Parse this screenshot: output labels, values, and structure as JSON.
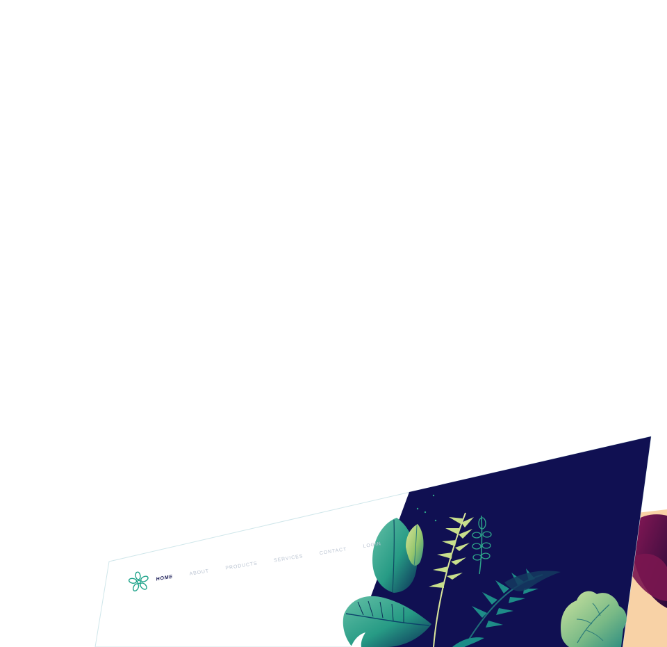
{
  "site": {
    "logo_icon": "leaf-flower-logo-icon",
    "nav": [
      {
        "label": "HOME",
        "active": true
      },
      {
        "label": "ABOUT",
        "active": false
      },
      {
        "label": "PRODUCTS",
        "active": false
      },
      {
        "label": "SERVICES",
        "active": false
      },
      {
        "label": "CONTACT",
        "active": false
      },
      {
        "label": "LOGIN",
        "active": false
      }
    ]
  },
  "theme": {
    "navy": "#101052",
    "teal": "#2ea58a",
    "lime": "#a7cd6c",
    "plum": "#5b1449",
    "peach": "#f8d2a6",
    "nav_inactive": "#b9c3d1",
    "nav_active": "#191b56"
  },
  "art": {
    "hero_icon": "tropical-leaves-illustration",
    "secondary_icon": "plum-leaves-card-illustration"
  }
}
